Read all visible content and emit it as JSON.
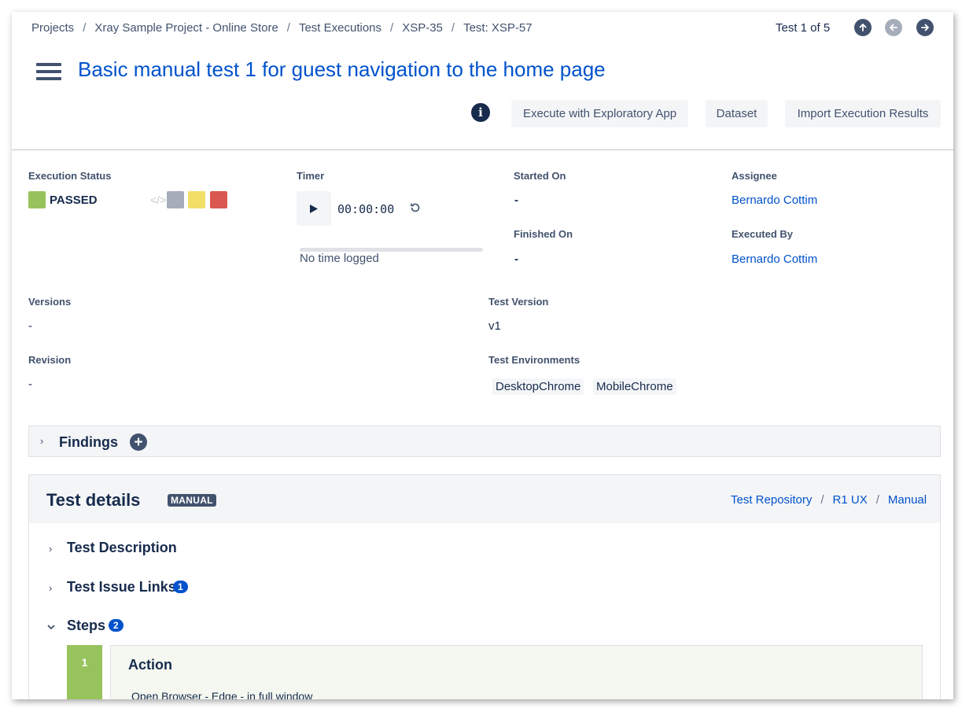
{
  "breadcrumb": [
    "Projects",
    "Xray Sample Project - Online Store",
    "Test Executions",
    "XSP-35",
    "Test: XSP-57"
  ],
  "pager": {
    "label": "Test 1 of 5",
    "up_icon": "arrow-up-icon",
    "prev_icon": "arrow-left-icon",
    "next_icon": "arrow-right-icon"
  },
  "title": "Basic manual test 1 for guest navigation to the home page",
  "actions": {
    "execute_exploratory": "Execute with Exploratory App",
    "dataset": "Dataset",
    "import_results": "Import Execution Results"
  },
  "execution_status": {
    "label": "Execution Status",
    "value": "PASSED",
    "colors": {
      "passed": "#97c35d",
      "todo": "#a5adba",
      "executing": "#f1df68",
      "failed": "#d9584f"
    }
  },
  "timer": {
    "label": "Timer",
    "time": "00:00:00",
    "logged": "No time logged"
  },
  "started_on": {
    "label": "Started On",
    "value": "-"
  },
  "finished_on": {
    "label": "Finished On",
    "value": "-"
  },
  "assignee": {
    "label": "Assignee",
    "value": "Bernardo Cottim"
  },
  "executed_by": {
    "label": "Executed By",
    "value": "Bernardo Cottim"
  },
  "versions": {
    "label": "Versions",
    "value": "-"
  },
  "test_version": {
    "label": "Test Version",
    "value": "v1"
  },
  "revision": {
    "label": "Revision",
    "value": "-"
  },
  "test_environments": {
    "label": "Test Environments",
    "values": [
      "DesktopChrome",
      "MobileChrome"
    ]
  },
  "findings": {
    "label": "Findings"
  },
  "test_details": {
    "title": "Test details",
    "badge": "MANUAL",
    "path": [
      "Test Repository",
      "R1 UX",
      "Manual"
    ],
    "sections": {
      "description": "Test Description",
      "issue_links": "Test Issue Links",
      "issue_links_count": "1",
      "steps": "Steps",
      "steps_count": "2"
    },
    "step": {
      "number": "1",
      "heading": "Action",
      "action": "Open Browser - Edge - in full window"
    }
  }
}
